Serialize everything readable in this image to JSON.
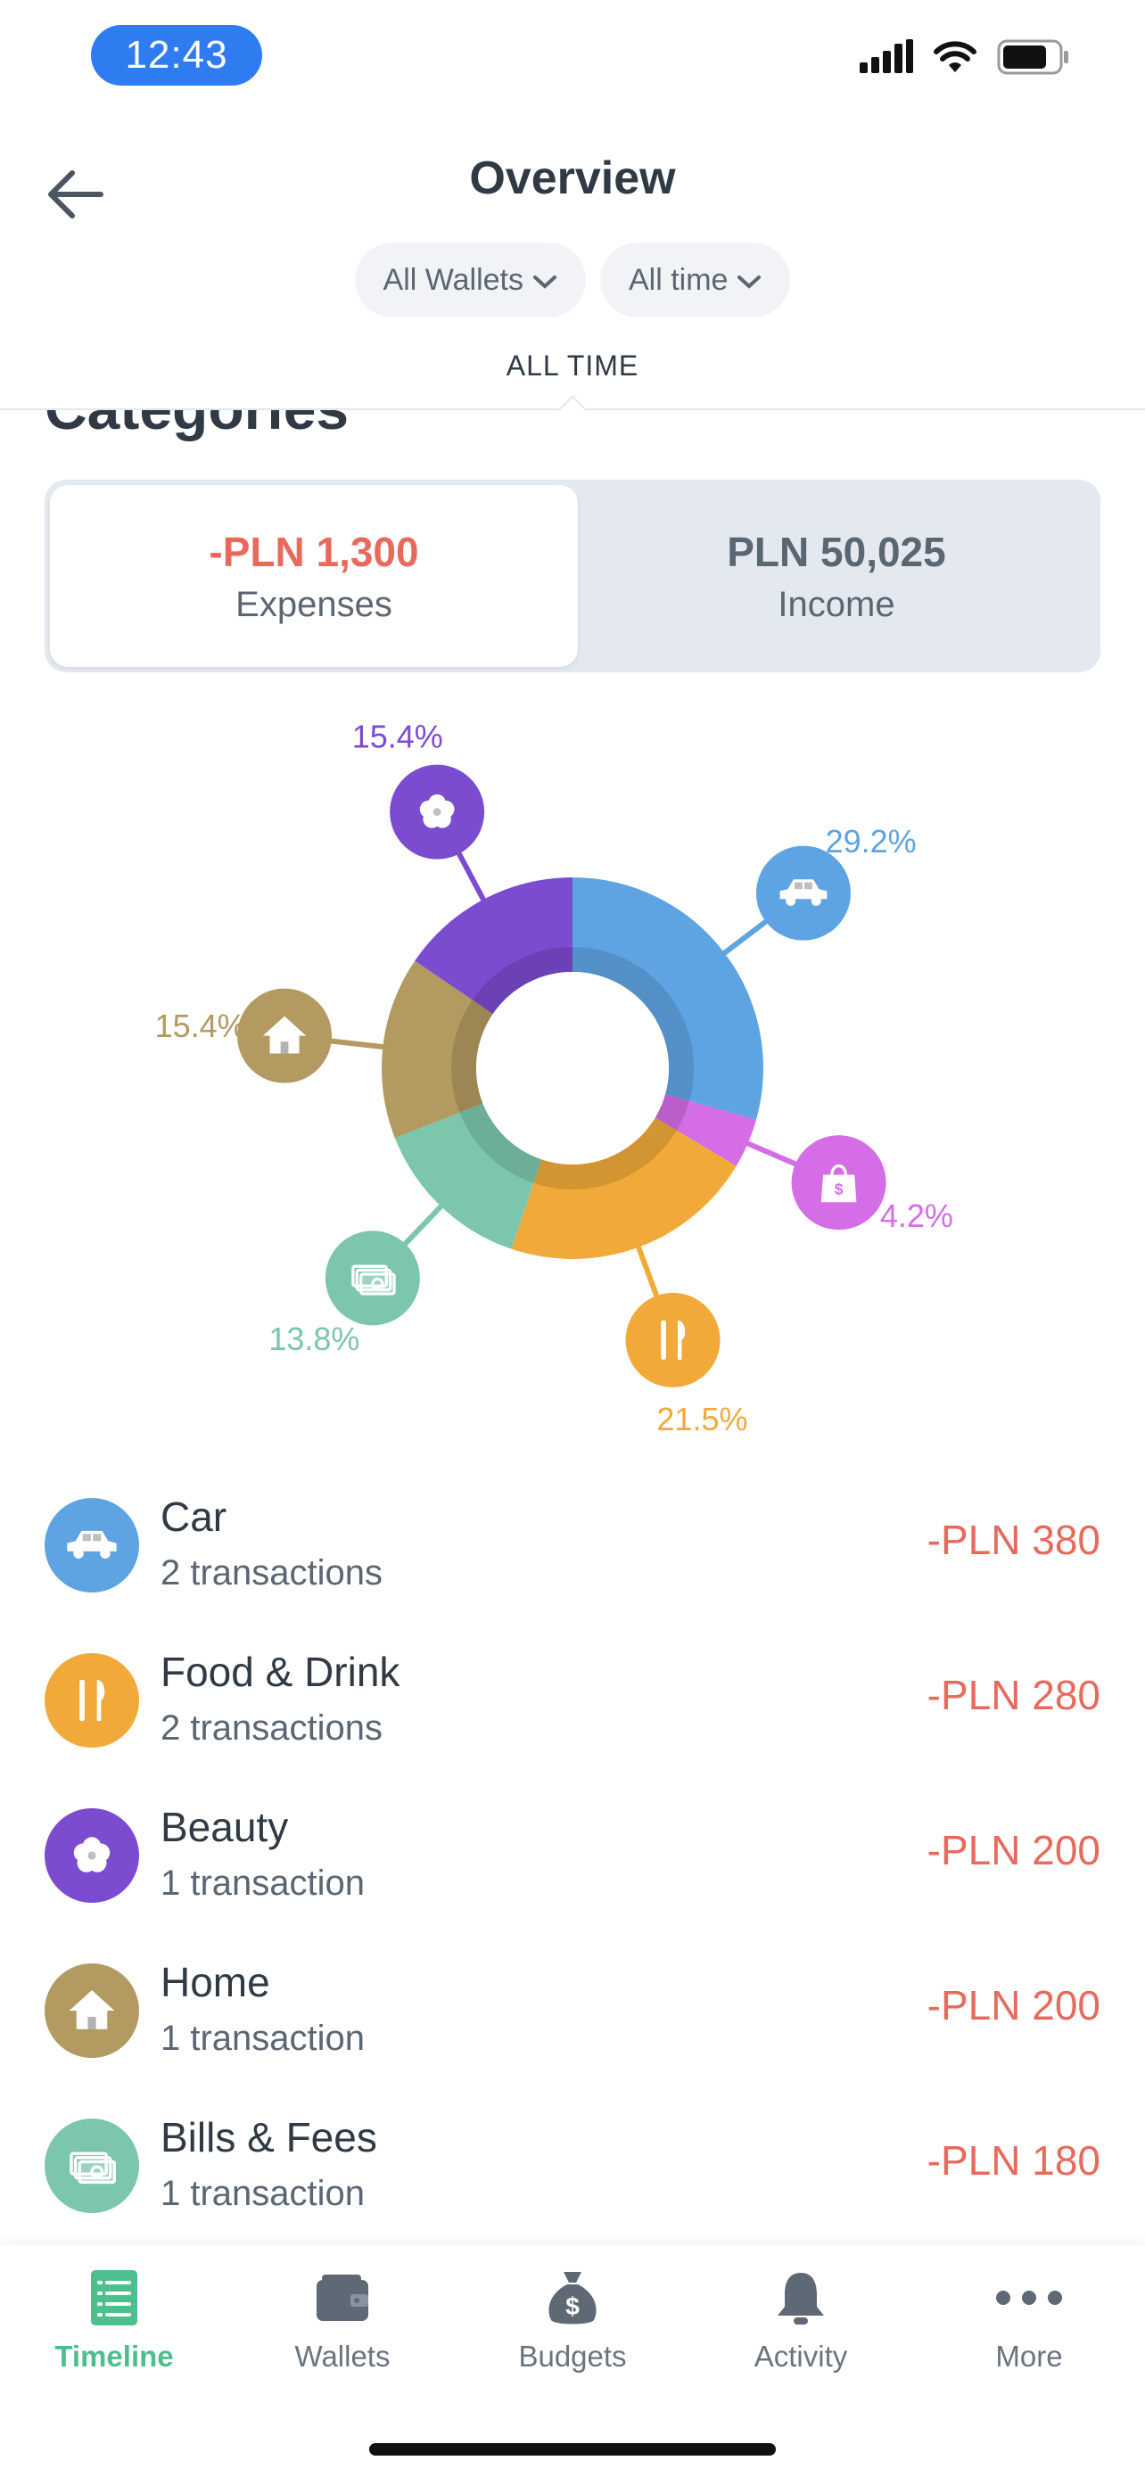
{
  "status": {
    "time": "12:43"
  },
  "header": {
    "title": "Overview",
    "wallet_filter": "All Wallets",
    "time_filter": "All time",
    "period": "ALL TIME"
  },
  "section_title": "Categories",
  "summary": {
    "expenses_value": "-PLN 1,300",
    "expenses_label": "Expenses",
    "income_value": "PLN 50,025",
    "income_label": "Income"
  },
  "chart_data": {
    "type": "pie",
    "categories": [
      "Car",
      "Beauty",
      "Home",
      "Bills & Fees",
      "Food & Drink",
      "Shopping"
    ],
    "values": [
      29.2,
      15.4,
      15.4,
      13.8,
      21.5,
      4.2
    ],
    "labels": [
      "29.2%",
      "15.4%",
      "15.4%",
      "13.8%",
      "21.5%",
      "4.2%"
    ],
    "colors": [
      "#5ea4e3",
      "#7b4bd0",
      "#b29a60",
      "#7cc6ab",
      "#f1aa3a",
      "#d46de6"
    ],
    "icons": [
      "car-icon",
      "flower-icon",
      "house-icon",
      "cash-icon",
      "fork-knife-icon",
      "shopping-bag-icon"
    ]
  },
  "categories": [
    {
      "name": "Car",
      "sub": "2 transactions",
      "amount": "-PLN 380",
      "color": "#5ea4e3",
      "icon": "car-icon"
    },
    {
      "name": "Food & Drink",
      "sub": "2 transactions",
      "amount": "-PLN 280",
      "color": "#f1aa3a",
      "icon": "fork-knife-icon"
    },
    {
      "name": "Beauty",
      "sub": "1 transaction",
      "amount": "-PLN 200",
      "color": "#7b4bd0",
      "icon": "flower-icon"
    },
    {
      "name": "Home",
      "sub": "1 transaction",
      "amount": "-PLN 200",
      "color": "#b29a60",
      "icon": "house-icon"
    },
    {
      "name": "Bills & Fees",
      "sub": "1 transaction",
      "amount": "-PLN 180",
      "color": "#7cc6ab",
      "icon": "cash-icon"
    }
  ],
  "tabs": [
    {
      "label": "Timeline",
      "icon": "timeline-icon",
      "active": true
    },
    {
      "label": "Wallets",
      "icon": "wallet-icon",
      "active": false
    },
    {
      "label": "Budgets",
      "icon": "money-bag-icon",
      "active": false
    },
    {
      "label": "Activity",
      "icon": "bell-icon",
      "active": false
    },
    {
      "label": "More",
      "icon": "more-dots-icon",
      "active": false
    }
  ],
  "colors": {
    "expense": "#e86a5c",
    "income_value": "#5b6673",
    "accent": "#4cbf8c"
  }
}
